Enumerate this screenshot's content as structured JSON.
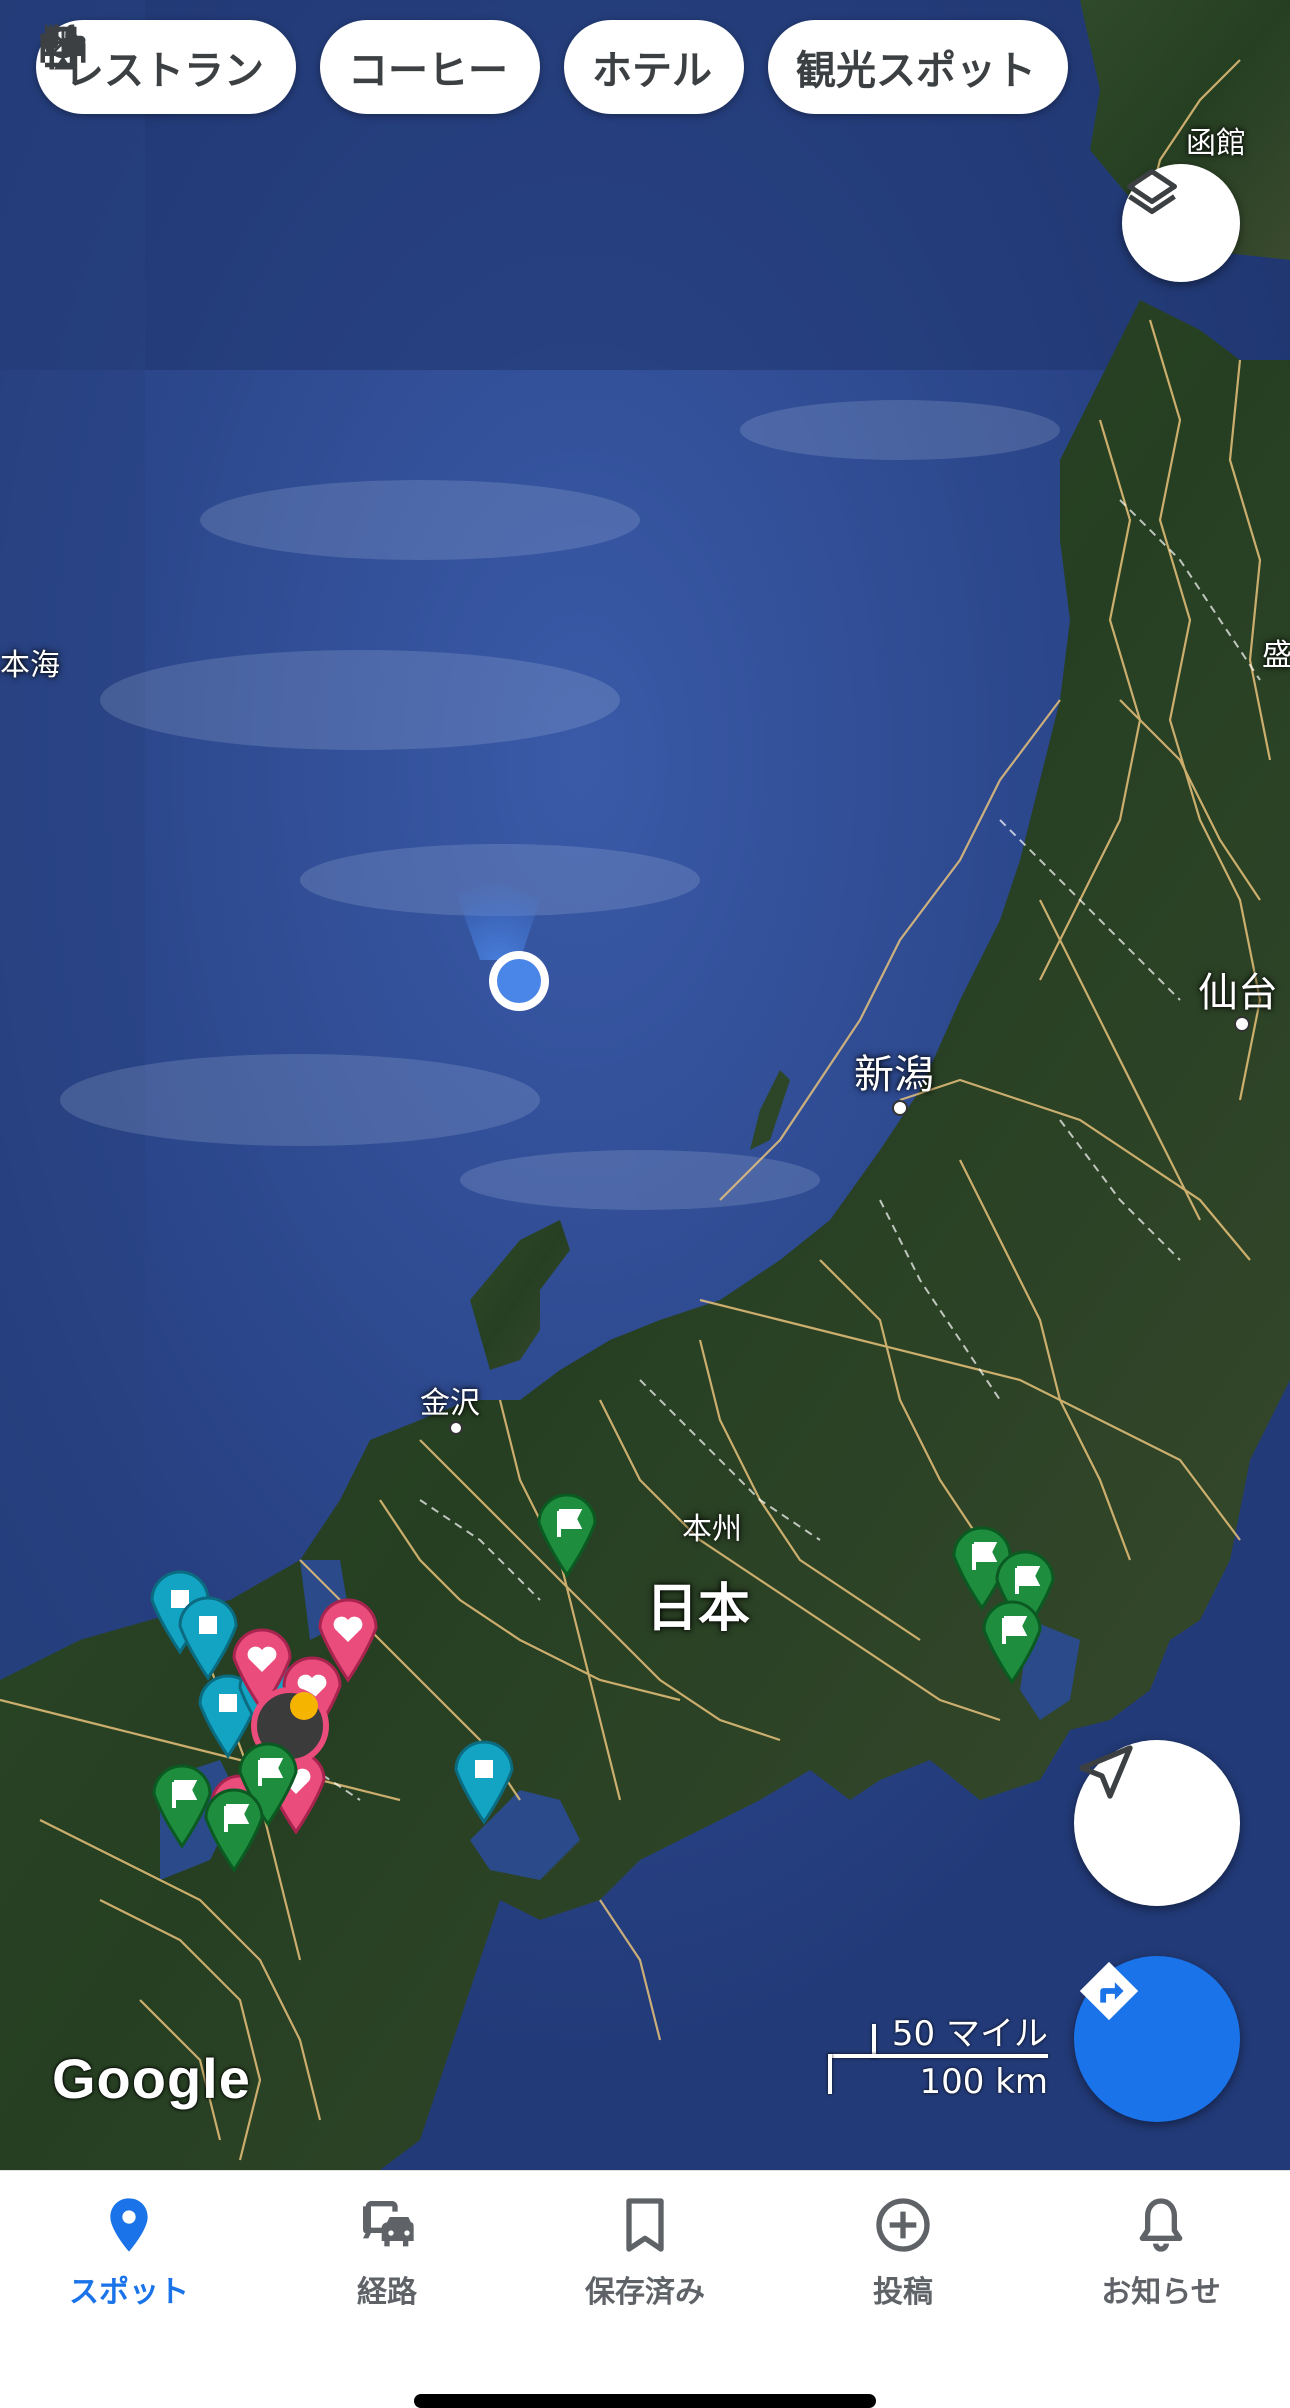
{
  "categories": [
    {
      "label": "レストラン",
      "icon": "restaurant-icon"
    },
    {
      "label": "コーヒー",
      "icon": "coffee-icon"
    },
    {
      "label": "ホテル",
      "icon": "hotel-icon"
    },
    {
      "label": "観光スポット",
      "icon": "attractions-icon"
    }
  ],
  "map": {
    "labels": {
      "hakodate": "函館",
      "sea_of_japan": "本海",
      "morioka": "盛",
      "sendai": "仙台",
      "niigata": "新潟",
      "kanazawa": "金沢",
      "honshu": "本州",
      "japan": "日本"
    },
    "map_type": "satellite",
    "attribution": "Google",
    "scale": {
      "miles": "50 マイル",
      "km": "100 km"
    },
    "pin_types": [
      "saved-flag",
      "favorite-heart",
      "want-to-go-flag",
      "starred"
    ],
    "colors": {
      "accent": "#1a73e8",
      "pin_green": "#1e8e3e",
      "pin_teal": "#12a4c2",
      "pin_pink": "#ea4c7c",
      "pin_yellow": "#f5b400",
      "road": "#e8c27a"
    }
  },
  "controls": {
    "layers": "layers-icon",
    "my_location": "navigation-arrow-icon",
    "directions": "directions-icon"
  },
  "nav": {
    "items": [
      {
        "label": "スポット",
        "icon": "place-pin-icon",
        "active": true
      },
      {
        "label": "経路",
        "icon": "commute-icon",
        "active": false
      },
      {
        "label": "保存済み",
        "icon": "bookmark-icon",
        "active": false
      },
      {
        "label": "投稿",
        "icon": "add-circle-icon",
        "active": false
      },
      {
        "label": "お知らせ",
        "icon": "bell-icon",
        "active": false
      }
    ]
  }
}
